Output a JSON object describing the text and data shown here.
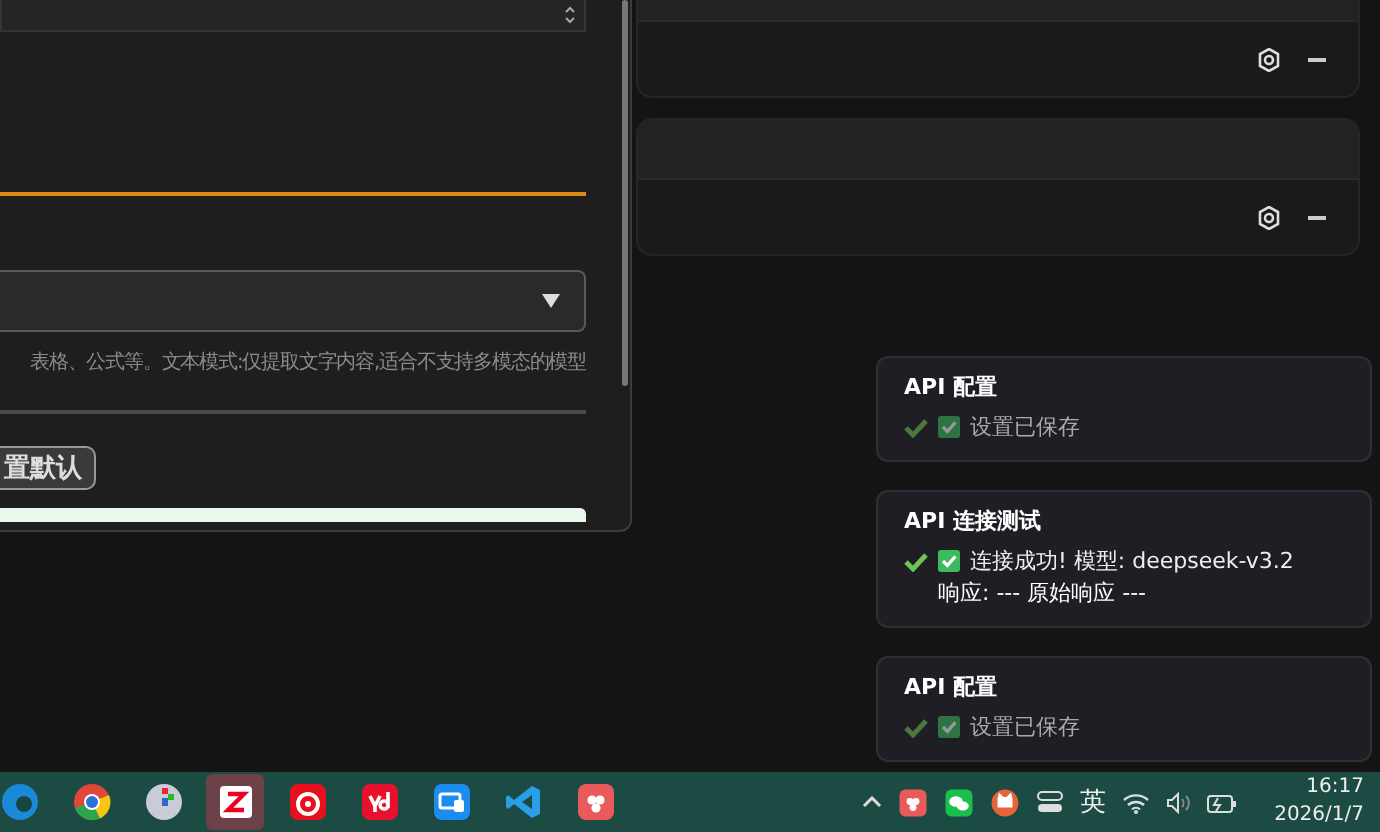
{
  "dialog": {
    "hint": "表格、公式等。文本模式:仅提取文字内容,适合不支持多模态的模型",
    "reset_button": "置默认"
  },
  "cards": [
    {
      "cut_off": true
    },
    {
      "cut_off": false
    }
  ],
  "toasts": [
    {
      "title": "API 配置",
      "message": "设置已保存",
      "faded": true
    },
    {
      "title": "API 连接测试",
      "message": "连接成功! 模型: deepseek-v3.2",
      "extra": "响应: --- 原始响应 ---",
      "faded": false
    },
    {
      "title": "API 配置",
      "message": "设置已保存",
      "faded": true
    }
  ],
  "taskbar": {
    "apps": [
      {
        "kind": "edge",
        "selected": false
      },
      {
        "kind": "chrome",
        "selected": false
      },
      {
        "kind": "monitor",
        "selected": false
      },
      {
        "kind": "zletter",
        "selected": true
      },
      {
        "kind": "music",
        "selected": false
      },
      {
        "kind": "dict",
        "selected": false
      },
      {
        "kind": "remote",
        "selected": false
      },
      {
        "kind": "code",
        "selected": false
      },
      {
        "kind": "berry",
        "selected": false
      }
    ],
    "tray": {
      "language": "英",
      "time": "16:17",
      "date": "2026/1/7"
    }
  }
}
